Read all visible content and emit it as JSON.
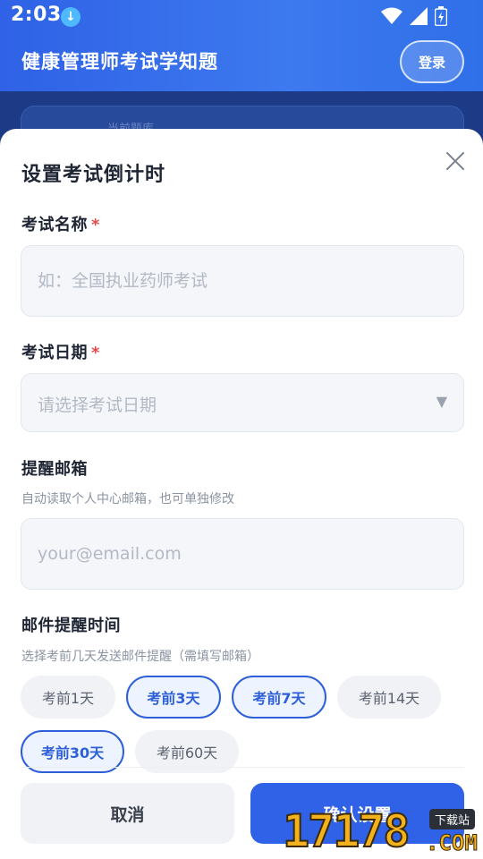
{
  "status": {
    "time": "2:03",
    "download_icon": "download-icon",
    "wifi_icon": "wifi-icon",
    "signal_icon": "signal-icon",
    "battery_icon": "battery-icon"
  },
  "header": {
    "title": "健康管理师考试学知题",
    "login_label": "登录"
  },
  "background": {
    "card_text": "当前题库"
  },
  "sheet": {
    "title": "设置考试倒计时",
    "close_icon": "close-icon",
    "exam_name": {
      "label": "考试名称",
      "required_mark": "*",
      "placeholder": "如：全国执业药师考试",
      "value": ""
    },
    "exam_date": {
      "label": "考试日期",
      "required_mark": "*",
      "placeholder": "请选择考试日期",
      "caret": "▼"
    },
    "email": {
      "label": "提醒邮箱",
      "hint": "自动读取个人中心邮箱，也可单独修改",
      "placeholder": "your@email.com",
      "value": ""
    },
    "reminder": {
      "label": "邮件提醒时间",
      "hint": "选择考前几天发送邮件提醒（需填写邮箱）",
      "options": [
        {
          "label": "考前1天",
          "selected": false
        },
        {
          "label": "考前3天",
          "selected": true
        },
        {
          "label": "考前7天",
          "selected": true
        },
        {
          "label": "考前14天",
          "selected": false
        },
        {
          "label": "考前30天",
          "selected": true
        },
        {
          "label": "考前60天",
          "selected": false
        }
      ]
    },
    "cancel_label": "取消",
    "confirm_label": "确认设置"
  },
  "watermark": {
    "number": "17178",
    "domain": ".COM",
    "tag": "下载站"
  },
  "colors": {
    "primary": "#2f62e6",
    "required": "#e5484d",
    "chip_selected_border": "#2d5fd9"
  }
}
